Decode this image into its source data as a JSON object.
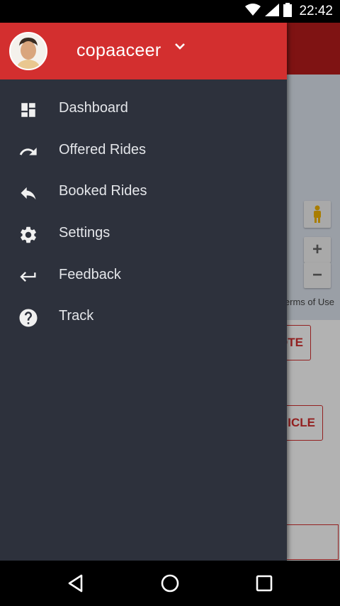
{
  "status_bar": {
    "time": "22:42",
    "icons": [
      "wifi-icon",
      "signal-icon",
      "battery-icon"
    ]
  },
  "background": {
    "map_terms": "erms of Use",
    "zoom_in": "+",
    "zoom_out": "−",
    "button_1": "OTE",
    "button_2": "ICLE"
  },
  "drawer": {
    "username": "copaaceer",
    "header_color": "#d32f2f",
    "items": [
      {
        "label": "Dashboard",
        "icon": "dashboard-icon"
      },
      {
        "label": "Offered Rides",
        "icon": "redo-icon"
      },
      {
        "label": "Booked Rides",
        "icon": "reply-icon"
      },
      {
        "label": "Settings",
        "icon": "gear-icon"
      },
      {
        "label": "Feedback",
        "icon": "return-icon"
      },
      {
        "label": "Track",
        "icon": "help-icon"
      }
    ]
  },
  "nav_bar": {
    "buttons": [
      "back-icon",
      "home-icon",
      "recents-icon"
    ]
  }
}
